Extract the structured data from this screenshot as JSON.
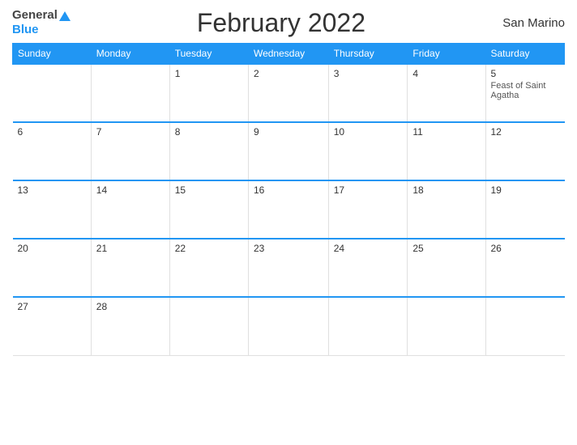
{
  "header": {
    "title": "February 2022",
    "country": "San Marino"
  },
  "logo": {
    "line1": "General",
    "line2": "Blue"
  },
  "calendar": {
    "days_of_week": [
      "Sunday",
      "Monday",
      "Tuesday",
      "Wednesday",
      "Thursday",
      "Friday",
      "Saturday"
    ],
    "weeks": [
      [
        {
          "day": "",
          "event": ""
        },
        {
          "day": "",
          "event": ""
        },
        {
          "day": "1",
          "event": ""
        },
        {
          "day": "2",
          "event": ""
        },
        {
          "day": "3",
          "event": ""
        },
        {
          "day": "4",
          "event": ""
        },
        {
          "day": "5",
          "event": "Feast of Saint Agatha"
        }
      ],
      [
        {
          "day": "6",
          "event": ""
        },
        {
          "day": "7",
          "event": ""
        },
        {
          "day": "8",
          "event": ""
        },
        {
          "day": "9",
          "event": ""
        },
        {
          "day": "10",
          "event": ""
        },
        {
          "day": "11",
          "event": ""
        },
        {
          "day": "12",
          "event": ""
        }
      ],
      [
        {
          "day": "13",
          "event": ""
        },
        {
          "day": "14",
          "event": ""
        },
        {
          "day": "15",
          "event": ""
        },
        {
          "day": "16",
          "event": ""
        },
        {
          "day": "17",
          "event": ""
        },
        {
          "day": "18",
          "event": ""
        },
        {
          "day": "19",
          "event": ""
        }
      ],
      [
        {
          "day": "20",
          "event": ""
        },
        {
          "day": "21",
          "event": ""
        },
        {
          "day": "22",
          "event": ""
        },
        {
          "day": "23",
          "event": ""
        },
        {
          "day": "24",
          "event": ""
        },
        {
          "day": "25",
          "event": ""
        },
        {
          "day": "26",
          "event": ""
        }
      ],
      [
        {
          "day": "27",
          "event": ""
        },
        {
          "day": "28",
          "event": ""
        },
        {
          "day": "",
          "event": ""
        },
        {
          "day": "",
          "event": ""
        },
        {
          "day": "",
          "event": ""
        },
        {
          "day": "",
          "event": ""
        },
        {
          "day": "",
          "event": ""
        }
      ]
    ]
  },
  "colors": {
    "header_bg": "#2196F3",
    "accent": "#2196F3"
  }
}
